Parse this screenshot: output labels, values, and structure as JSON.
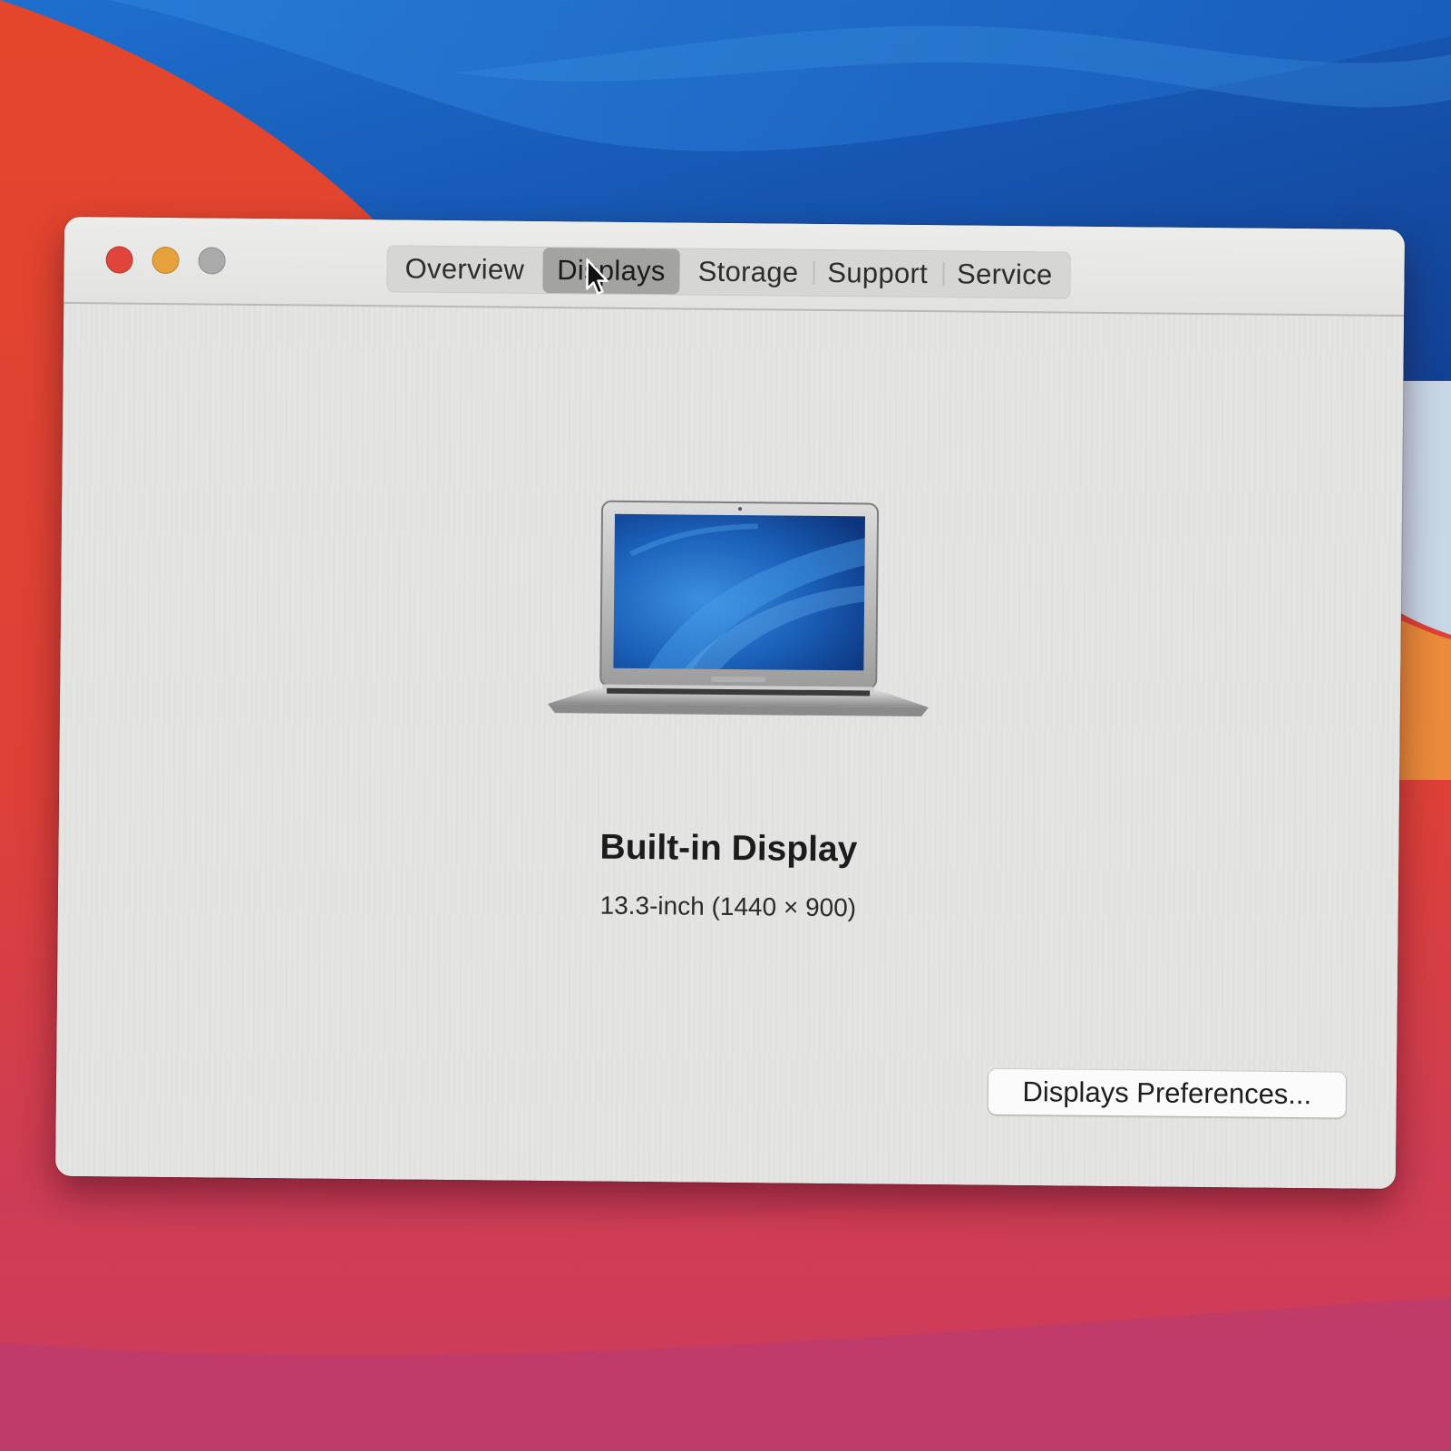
{
  "window": {
    "controls": [
      "close",
      "minimize",
      "zoom"
    ]
  },
  "tabs": [
    {
      "label": "Overview",
      "active": false
    },
    {
      "label": "Displays",
      "active": true
    },
    {
      "label": "Storage",
      "active": false
    },
    {
      "label": "Support",
      "active": false
    },
    {
      "label": "Service",
      "active": false
    }
  ],
  "display": {
    "name": "Built-in Display",
    "spec": "13.3-inch (1440 × 900)",
    "icon": "laptop-icon"
  },
  "actions": {
    "preferences_label": "Displays Preferences..."
  },
  "colors": {
    "close": "#e0443a",
    "minimize": "#e5a23c",
    "zoom": "#aaaaaa",
    "wallpaper_blue": "#1b5fbe",
    "wallpaper_red": "#e2452f"
  }
}
